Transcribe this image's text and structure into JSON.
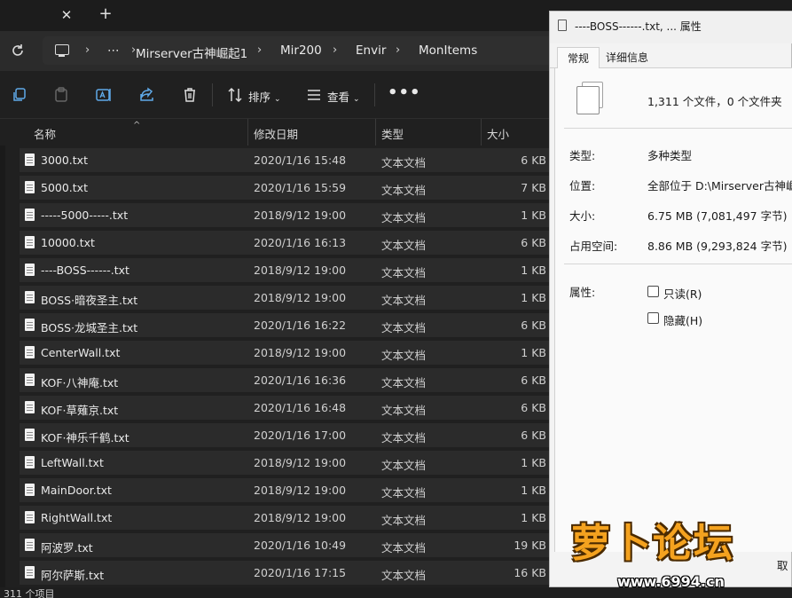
{
  "tabstrip": {
    "close_glyph": "✕",
    "new_glyph": "+"
  },
  "breadcrumb": {
    "more": "⋯",
    "items": [
      "Mirserver古神崛起1",
      "Mir200",
      "Envir",
      "MonItems"
    ]
  },
  "commandbar": {
    "sort_label": "排序",
    "view_label": "查看",
    "more_label": "•••"
  },
  "columns": {
    "name": "名称",
    "date": "修改日期",
    "type": "类型",
    "size": "大小"
  },
  "files": [
    {
      "name": "3000.txt",
      "date": "2020/1/16 15:48",
      "type": "文本文档",
      "size": "6 KB"
    },
    {
      "name": "5000.txt",
      "date": "2020/1/16 15:59",
      "type": "文本文档",
      "size": "7 KB"
    },
    {
      "name": "-----5000-----.txt",
      "date": "2018/9/12 19:00",
      "type": "文本文档",
      "size": "1 KB"
    },
    {
      "name": "10000.txt",
      "date": "2020/1/16 16:13",
      "type": "文本文档",
      "size": "6 KB"
    },
    {
      "name": "----BOSS------.txt",
      "date": "2018/9/12 19:00",
      "type": "文本文档",
      "size": "1 KB"
    },
    {
      "name": "BOSS·暗夜圣主.txt",
      "date": "2018/9/12 19:00",
      "type": "文本文档",
      "size": "1 KB"
    },
    {
      "name": "BOSS·龙城圣主.txt",
      "date": "2020/1/16 16:22",
      "type": "文本文档",
      "size": "6 KB"
    },
    {
      "name": "CenterWall.txt",
      "date": "2018/9/12 19:00",
      "type": "文本文档",
      "size": "1 KB"
    },
    {
      "name": "KOF·八神庵.txt",
      "date": "2020/1/16 16:36",
      "type": "文本文档",
      "size": "6 KB"
    },
    {
      "name": "KOF·草薙京.txt",
      "date": "2020/1/16 16:48",
      "type": "文本文档",
      "size": "6 KB"
    },
    {
      "name": "KOF·神乐千鹤.txt",
      "date": "2020/1/16 17:00",
      "type": "文本文档",
      "size": "6 KB"
    },
    {
      "name": "LeftWall.txt",
      "date": "2018/9/12 19:00",
      "type": "文本文档",
      "size": "1 KB"
    },
    {
      "name": "MainDoor.txt",
      "date": "2018/9/12 19:00",
      "type": "文本文档",
      "size": "1 KB"
    },
    {
      "name": "RightWall.txt",
      "date": "2018/9/12 19:00",
      "type": "文本文档",
      "size": "1 KB"
    },
    {
      "name": "阿波罗.txt",
      "date": "2020/1/16 10:49",
      "type": "文本文档",
      "size": "19 KB"
    },
    {
      "name": "阿尔萨斯.txt",
      "date": "2020/1/16 17:15",
      "type": "文本文档",
      "size": "16 KB"
    }
  ],
  "status": {
    "text": "311 个项目"
  },
  "dialog": {
    "title": "----BOSS------.txt, ... 属性",
    "tab_general": "常规",
    "tab_details": "详细信息",
    "count": "1,311 个文件，0 个文件夹",
    "type_label": "类型:",
    "type_value": "多种类型",
    "location_label": "位置:",
    "location_value": "全部位于 D:\\Mirserver古神崛起",
    "size_label": "大小:",
    "size_value": "6.75 MB (7,081,497 字节)",
    "disk_label": "占用空间:",
    "disk_value": "8.86 MB (9,293,824 字节)",
    "attr_label": "属性:",
    "readonly_label": "只读(R)",
    "hidden_label": "隐藏(H)",
    "cancel_partial": "取"
  },
  "watermark": {
    "text": "萝卜论坛",
    "url": "www.6994.cn"
  }
}
